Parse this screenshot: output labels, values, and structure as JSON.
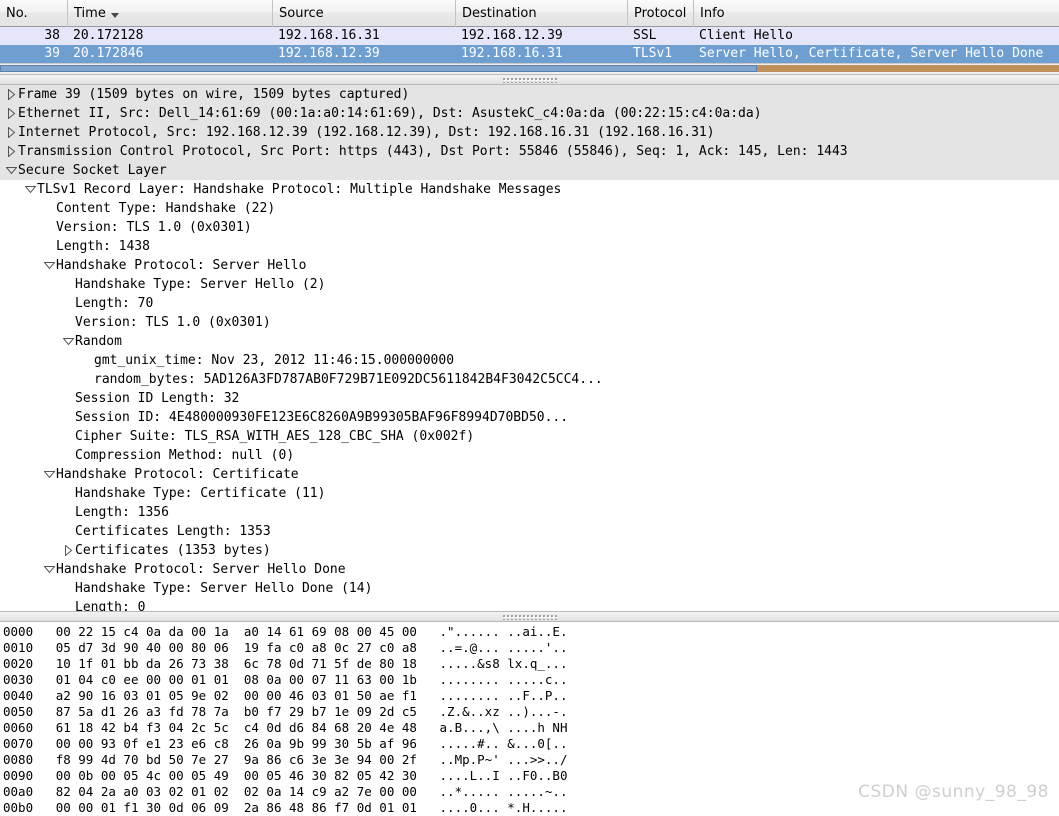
{
  "packet_list": {
    "columns": [
      {
        "label": "No.",
        "sorted": false
      },
      {
        "label": "Time",
        "sorted": true
      },
      {
        "label": "Source",
        "sorted": false
      },
      {
        "label": "Destination",
        "sorted": false
      },
      {
        "label": "Protocol",
        "sorted": false
      },
      {
        "label": "Info",
        "sorted": false
      }
    ],
    "rows": [
      {
        "no": "38",
        "time": "20.172128",
        "source": "192.168.16.31",
        "destination": "192.168.12.39",
        "protocol": "SSL",
        "info": "Client Hello",
        "selected": false
      },
      {
        "no": "39",
        "time": "20.172846",
        "source": "192.168.12.39",
        "destination": "192.168.16.31",
        "protocol": "TLSv1",
        "info": "Server Hello, Certificate, Server Hello Done",
        "selected": true
      }
    ],
    "selected_row_color": "#6f9fd1",
    "unselected_row_color": "#e6e6fa"
  },
  "detail_tree": [
    {
      "indent": 0,
      "twisty": "collapsed",
      "shaded": true,
      "text": "Frame 39 (1509 bytes on wire, 1509 bytes captured)"
    },
    {
      "indent": 0,
      "twisty": "collapsed",
      "shaded": true,
      "text": "Ethernet II, Src: Dell_14:61:69 (00:1a:a0:14:61:69), Dst: AsustekC_c4:0a:da (00:22:15:c4:0a:da)"
    },
    {
      "indent": 0,
      "twisty": "collapsed",
      "shaded": true,
      "text": "Internet Protocol, Src: 192.168.12.39 (192.168.12.39), Dst: 192.168.16.31 (192.168.16.31)"
    },
    {
      "indent": 0,
      "twisty": "collapsed",
      "shaded": true,
      "text": "Transmission Control Protocol, Src Port: https (443), Dst Port: 55846 (55846), Seq: 1, Ack: 145, Len: 1443"
    },
    {
      "indent": 0,
      "twisty": "expanded",
      "shaded": true,
      "text": "Secure Socket Layer"
    },
    {
      "indent": 1,
      "twisty": "expanded",
      "shaded": false,
      "text": "TLSv1 Record Layer: Handshake Protocol: Multiple Handshake Messages"
    },
    {
      "indent": 2,
      "twisty": "none",
      "shaded": false,
      "text": "Content Type: Handshake (22)"
    },
    {
      "indent": 2,
      "twisty": "none",
      "shaded": false,
      "text": "Version: TLS 1.0 (0x0301)"
    },
    {
      "indent": 2,
      "twisty": "none",
      "shaded": false,
      "text": "Length: 1438"
    },
    {
      "indent": 2,
      "twisty": "expanded",
      "shaded": false,
      "text": "Handshake Protocol: Server Hello"
    },
    {
      "indent": 3,
      "twisty": "none",
      "shaded": false,
      "text": "Handshake Type: Server Hello (2)"
    },
    {
      "indent": 3,
      "twisty": "none",
      "shaded": false,
      "text": "Length: 70"
    },
    {
      "indent": 3,
      "twisty": "none",
      "shaded": false,
      "text": "Version: TLS 1.0 (0x0301)"
    },
    {
      "indent": 3,
      "twisty": "expanded",
      "shaded": false,
      "text": "Random"
    },
    {
      "indent": 4,
      "twisty": "none",
      "shaded": false,
      "text": "gmt_unix_time: Nov 23, 2012 11:46:15.000000000"
    },
    {
      "indent": 4,
      "twisty": "none",
      "shaded": false,
      "text": "random_bytes: 5AD126A3FD787AB0F729B71E092DC5611842B4F3042C5CC4..."
    },
    {
      "indent": 3,
      "twisty": "none",
      "shaded": false,
      "text": "Session ID Length: 32"
    },
    {
      "indent": 3,
      "twisty": "none",
      "shaded": false,
      "text": "Session ID: 4E480000930FE123E6C8260A9B99305BAF96F8994D70BD50..."
    },
    {
      "indent": 3,
      "twisty": "none",
      "shaded": false,
      "text": "Cipher Suite: TLS_RSA_WITH_AES_128_CBC_SHA (0x002f)"
    },
    {
      "indent": 3,
      "twisty": "none",
      "shaded": false,
      "text": "Compression Method: null (0)"
    },
    {
      "indent": 2,
      "twisty": "expanded",
      "shaded": false,
      "text": "Handshake Protocol: Certificate"
    },
    {
      "indent": 3,
      "twisty": "none",
      "shaded": false,
      "text": "Handshake Type: Certificate (11)"
    },
    {
      "indent": 3,
      "twisty": "none",
      "shaded": false,
      "text": "Length: 1356"
    },
    {
      "indent": 3,
      "twisty": "none",
      "shaded": false,
      "text": "Certificates Length: 1353"
    },
    {
      "indent": 3,
      "twisty": "collapsed",
      "shaded": false,
      "text": "Certificates (1353 bytes)"
    },
    {
      "indent": 2,
      "twisty": "expanded",
      "shaded": false,
      "text": "Handshake Protocol: Server Hello Done"
    },
    {
      "indent": 3,
      "twisty": "none",
      "shaded": false,
      "text": "Handshake Type: Server Hello Done (14)"
    },
    {
      "indent": 3,
      "twisty": "none",
      "shaded": false,
      "text": "Length: 0"
    }
  ],
  "hex_dump": [
    {
      "offset": "0000",
      "bytes_left": "00 22 15 c4 0a da 00 1a",
      "bytes_right": "a0 14 61 69 08 00 45 00",
      "ascii_left": ".\"......",
      "ascii_right": "..ai..E."
    },
    {
      "offset": "0010",
      "bytes_left": "05 d7 3d 90 40 00 80 06",
      "bytes_right": "19 fa c0 a8 0c 27 c0 a8",
      "ascii_left": "..=.@...",
      "ascii_right": ".....'.."
    },
    {
      "offset": "0020",
      "bytes_left": "10 1f 01 bb da 26 73 38",
      "bytes_right": "6c 78 0d 71 5f de 80 18",
      "ascii_left": ".....&s8",
      "ascii_right": "lx.q_..."
    },
    {
      "offset": "0030",
      "bytes_left": "01 04 c0 ee 00 00 01 01",
      "bytes_right": "08 0a 00 07 11 63 00 1b",
      "ascii_left": "........",
      "ascii_right": ".....c.."
    },
    {
      "offset": "0040",
      "bytes_left": "a2 90 16 03 01 05 9e 02",
      "bytes_right": "00 00 46 03 01 50 ae f1",
      "ascii_left": "........",
      "ascii_right": "..F..P.."
    },
    {
      "offset": "0050",
      "bytes_left": "87 5a d1 26 a3 fd 78 7a",
      "bytes_right": "b0 f7 29 b7 1e 09 2d c5",
      "ascii_left": ".Z.&..xz",
      "ascii_right": "..)...-."
    },
    {
      "offset": "0060",
      "bytes_left": "61 18 42 b4 f3 04 2c 5c",
      "bytes_right": "c4 0d d6 84 68 20 4e 48",
      "ascii_left": "a.B...,\\",
      "ascii_right": "....h NH"
    },
    {
      "offset": "0070",
      "bytes_left": "00 00 93 0f e1 23 e6 c8",
      "bytes_right": "26 0a 9b 99 30 5b af 96",
      "ascii_left": ".....#..",
      "ascii_right": "&...0[.."
    },
    {
      "offset": "0080",
      "bytes_left": "f8 99 4d 70 bd 50 7e 27",
      "bytes_right": "9a 86 c6 3e 3e 94 00 2f",
      "ascii_left": "..Mp.P~'",
      "ascii_right": "...>>../"
    },
    {
      "offset": "0090",
      "bytes_left": "00 0b 00 05 4c 00 05 49",
      "bytes_right": "00 05 46 30 82 05 42 30",
      "ascii_left": "....L..I",
      "ascii_right": "..F0..B0"
    },
    {
      "offset": "00a0",
      "bytes_left": "82 04 2a a0 03 02 01 02",
      "bytes_right": "02 0a 14 c9 a2 7e 00 00",
      "ascii_left": "..*.....",
      "ascii_right": ".....~.."
    },
    {
      "offset": "00b0",
      "bytes_left": "00 00 01 f1 30 0d 06 09",
      "bytes_right": "2a 86 48 86 f7 0d 01 01",
      "ascii_left": "....0...",
      "ascii_right": "*.H....."
    }
  ],
  "watermark": "CSDN @sunny_98_98"
}
